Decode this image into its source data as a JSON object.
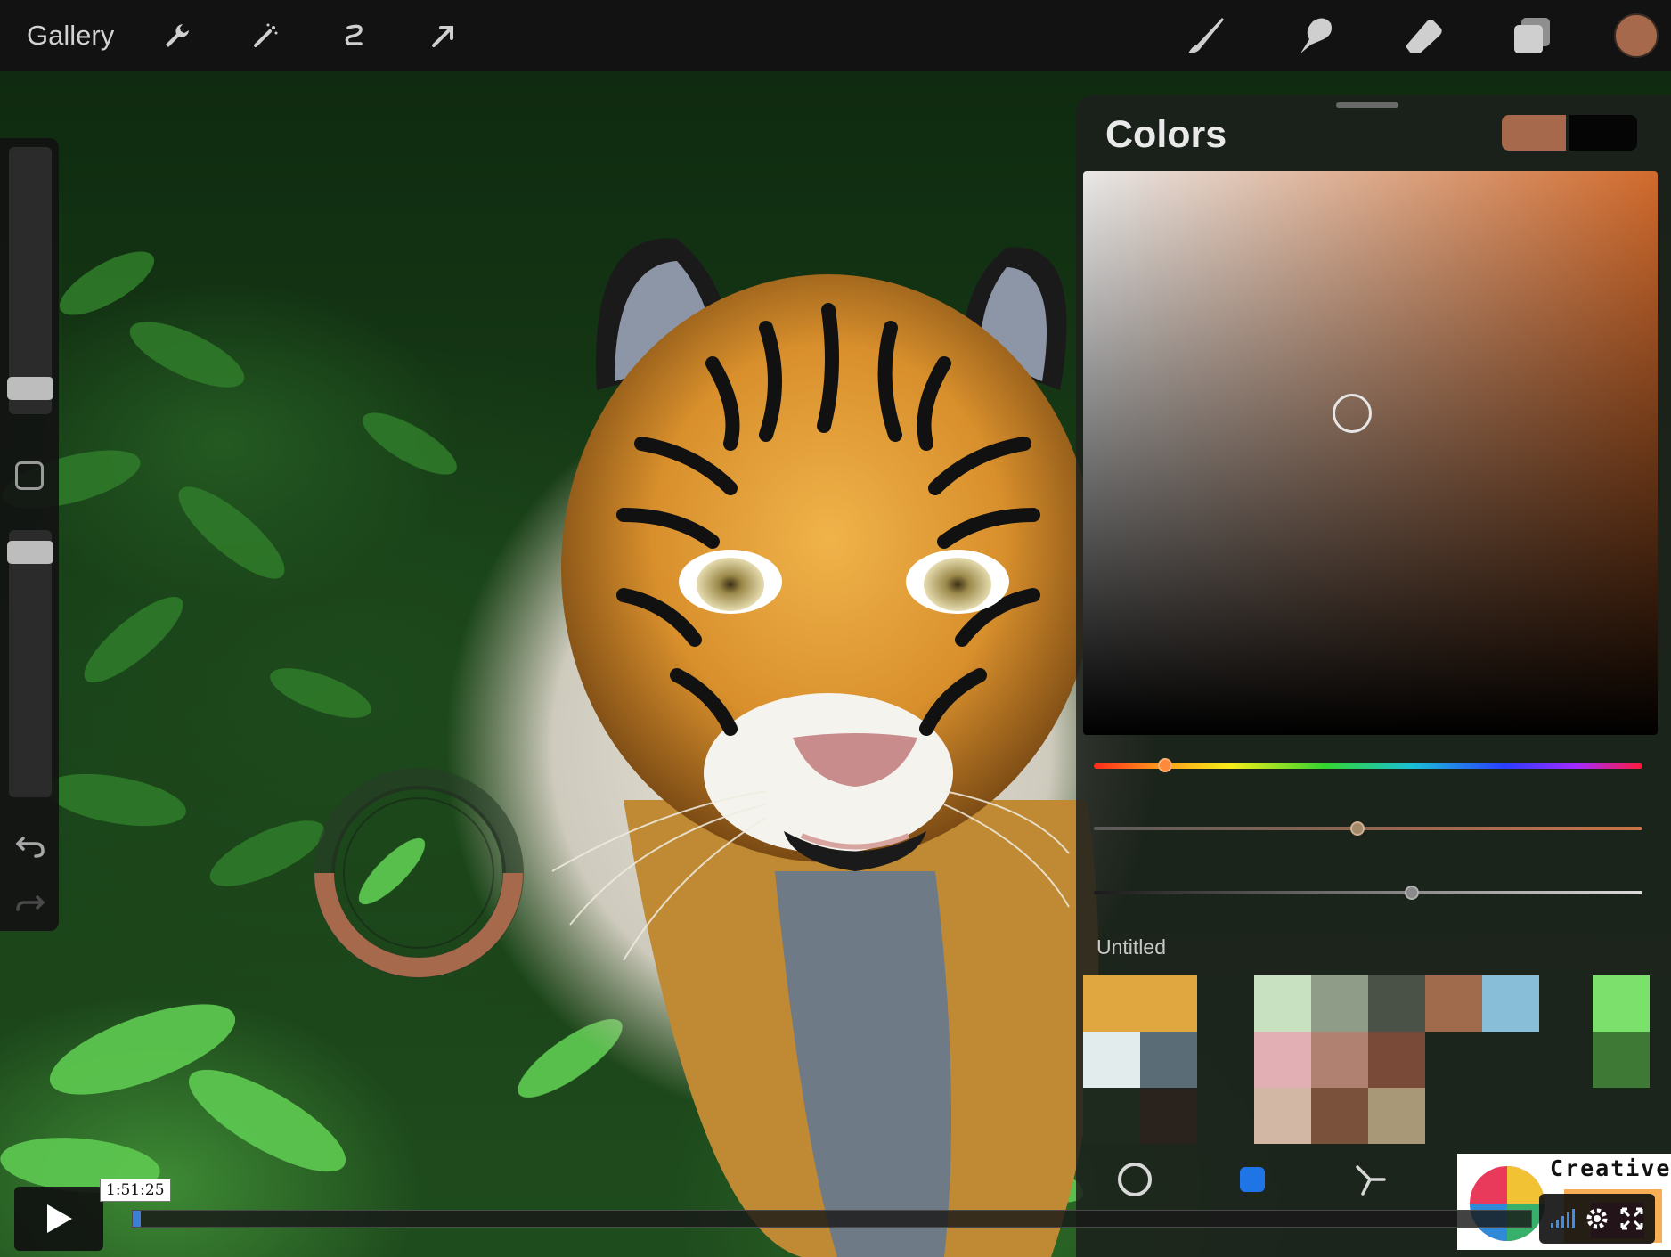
{
  "toolbar": {
    "gallery_label": "Gallery",
    "left_tools": [
      "wrench-icon",
      "magic-wand-icon",
      "selection-icon",
      "transform-arrow-icon"
    ],
    "right_tools": [
      "brush-icon",
      "smudge-icon",
      "eraser-icon",
      "layers-icon"
    ],
    "active_color": "#a6694b"
  },
  "colors_panel": {
    "title": "Colors",
    "primary_color": "#a6694b",
    "secondary_color": "#050505",
    "hue_position": 0.13,
    "saturation_position": 0.48,
    "brightness_position": 0.58,
    "palette_name": "Untitled",
    "palette_swatches": [
      "#e0a640",
      "#e0a640",
      "#c8e1c0",
      "#8e9c88",
      "#4a5146",
      "#a06a4c",
      "#88bed8",
      "#7ce06c",
      "#e2ecec",
      "#5a6c76",
      "#e2b0b4",
      "#b08070",
      "#7a4a38",
      "#3e7a36",
      "#1e2a1e",
      "#2a221c",
      "#d2b8a4",
      "#7a523c",
      "#a89878"
    ],
    "bottom_modes": [
      "disc-icon",
      "classic-square-icon",
      "harmony-icon"
    ]
  },
  "player": {
    "timestamp": "1:51:25",
    "progress": 0.006
  },
  "watermark": {
    "text": "Creative"
  }
}
